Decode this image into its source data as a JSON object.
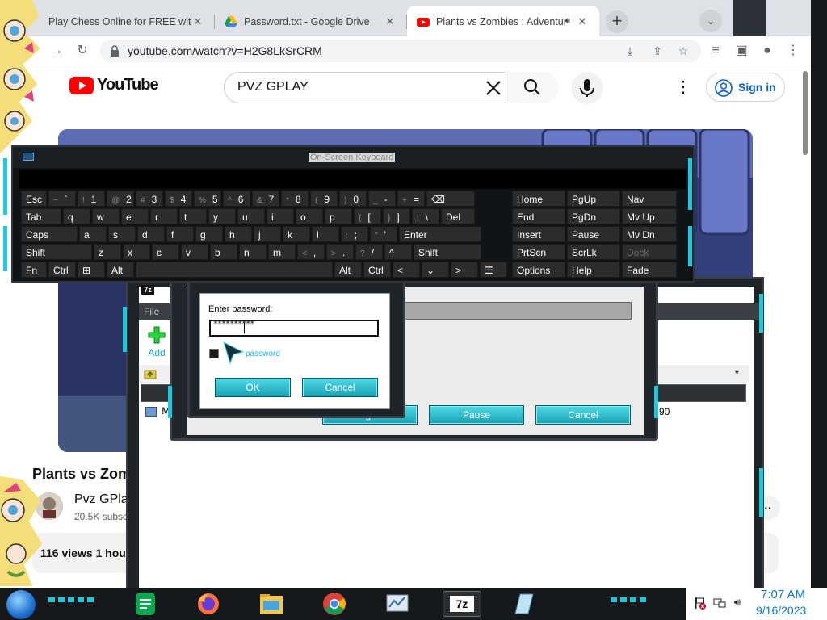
{
  "browser": {
    "tabs": [
      {
        "label": "Play Chess Online for FREE with F"
      },
      {
        "label": "Password.txt - Google Drive"
      },
      {
        "label": "Plants vs Zombies : Adventur"
      }
    ],
    "new_tab": "+",
    "url": "youtube.com/watch?v=H2G8LkSrCRM"
  },
  "youtube": {
    "logo_text": "YouTube",
    "search_value": "PVZ GPLAY",
    "sign_in": "Sign in",
    "video_title": "Plants vs Zom",
    "channel_name": "Pvz GPla",
    "channel_subs": "20.5K subsc",
    "meta": "116 views  1 hou"
  },
  "sevenzip": {
    "logo": "7z",
    "menu_file": "File",
    "add_label": "Add",
    "row_name": "M",
    "row_value": "90",
    "buttons": {
      "background": "Background",
      "pause": "Pause",
      "cancel": "Cancel"
    }
  },
  "password_dialog": {
    "label": "Enter password:",
    "masked_value": "**********",
    "show_label": "password",
    "ok": "OK",
    "cancel": "Cancel"
  },
  "osk": {
    "title": "On-Screen Keyboard",
    "rows": [
      [
        {
          "label": "Esc",
          "w": 34
        },
        {
          "sub": "~",
          "label": "`",
          "w": 36
        },
        {
          "sub": "!",
          "label": "1",
          "w": 36
        },
        {
          "sub": "@",
          "label": "2",
          "w": 36
        },
        {
          "sub": "#",
          "label": "3",
          "w": 36
        },
        {
          "sub": "$",
          "label": "4",
          "w": 36
        },
        {
          "sub": "%",
          "label": "5",
          "w": 36
        },
        {
          "sub": "^",
          "label": "6",
          "w": 36
        },
        {
          "sub": "&",
          "label": "7",
          "w": 36
        },
        {
          "sub": "*",
          "label": "8",
          "w": 36
        },
        {
          "sub": "(",
          "label": "9",
          "w": 36
        },
        {
          "sub": ")",
          "label": "0",
          "w": 36
        },
        {
          "sub": "_",
          "label": "-",
          "w": 36
        },
        {
          "sub": "+",
          "label": "=",
          "w": 36
        },
        {
          "label": "⌫",
          "w": 62
        }
      ],
      [
        {
          "label": "Tab",
          "w": 52
        },
        {
          "label": "q",
          "w": 36
        },
        {
          "label": "w",
          "w": 36
        },
        {
          "label": "e",
          "w": 36
        },
        {
          "label": "r",
          "w": 36
        },
        {
          "label": "t",
          "w": 36
        },
        {
          "label": "y",
          "w": 36
        },
        {
          "label": "u",
          "w": 36
        },
        {
          "label": "i",
          "w": 36
        },
        {
          "label": "o",
          "w": 36
        },
        {
          "label": "p",
          "w": 36
        },
        {
          "sub": "{",
          "label": "[",
          "w": 36
        },
        {
          "sub": "}",
          "label": "]",
          "w": 36
        },
        {
          "sub": "|",
          "label": "\\",
          "w": 36
        },
        {
          "label": "Del",
          "w": 44
        }
      ],
      [
        {
          "label": "Caps",
          "w": 72
        },
        {
          "label": "a",
          "w": 36
        },
        {
          "label": "s",
          "w": 36
        },
        {
          "label": "d",
          "w": 36
        },
        {
          "label": "f",
          "w": 36
        },
        {
          "label": "g",
          "w": 36
        },
        {
          "label": "h",
          "w": 36
        },
        {
          "label": "j",
          "w": 36
        },
        {
          "label": "k",
          "w": 36
        },
        {
          "label": "l",
          "w": 36
        },
        {
          "sub": ":",
          "label": ";",
          "w": 36
        },
        {
          "sub": "\"",
          "label": "'",
          "w": 36
        },
        {
          "label": "Enter",
          "w": 104
        }
      ],
      [
        {
          "label": "Shift",
          "w": 90
        },
        {
          "label": "z",
          "w": 36
        },
        {
          "label": "x",
          "w": 36
        },
        {
          "label": "c",
          "w": 36
        },
        {
          "label": "v",
          "w": 36
        },
        {
          "label": "b",
          "w": 36
        },
        {
          "label": "n",
          "w": 36
        },
        {
          "label": "m",
          "w": 36
        },
        {
          "sub": "<",
          "label": ",",
          "w": 36
        },
        {
          "sub": ">",
          "label": ".",
          "w": 36
        },
        {
          "sub": "?",
          "label": "/",
          "w": 36
        },
        {
          "label": "^",
          "w": 36
        },
        {
          "label": "Shift",
          "w": 86
        }
      ],
      [
        {
          "label": "Fn",
          "w": 34
        },
        {
          "label": "Ctrl",
          "w": 36
        },
        {
          "label": "⊞",
          "w": 36
        },
        {
          "label": "Alt",
          "w": 36
        },
        {
          "label": "",
          "w": 246
        },
        {
          "label": "Alt",
          "w": 36
        },
        {
          "label": "Ctrl",
          "w": 36
        },
        {
          "label": "<",
          "w": 36
        },
        {
          "label": "⌄",
          "w": 36
        },
        {
          "label": ">",
          "w": 36
        },
        {
          "label": "☰",
          "w": 36
        }
      ]
    ],
    "nav_rows": [
      [
        "Home",
        "PgUp",
        "Nav"
      ],
      [
        "End",
        "PgDn",
        "Mv Up"
      ],
      [
        "Insert",
        "Pause",
        "Mv Dn"
      ],
      [
        "PrtScn",
        "ScrLk",
        "Dock"
      ],
      [
        "Options",
        "Help",
        "Fade"
      ]
    ]
  },
  "taskbar": {
    "time": "7:07 AM",
    "date": "9/16/2023",
    "sevenzip_label": "7z"
  },
  "colors": {
    "accent_cyan": "#1ec8dc",
    "youtube_red": "#ff0000",
    "signin_blue": "#065fd4"
  }
}
